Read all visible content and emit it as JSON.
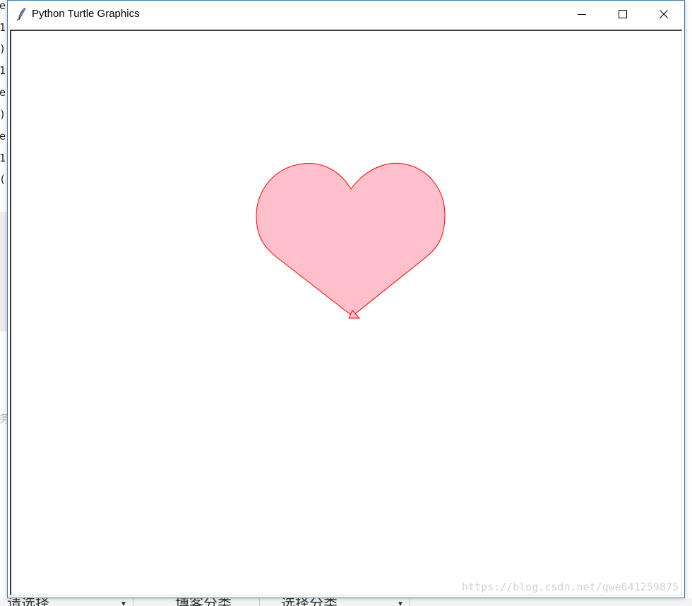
{
  "background": {
    "code_edge_chars": [
      "e",
      "1",
      ")",
      "1",
      "e",
      ")",
      "e",
      "1",
      "("
    ],
    "ghost_char": "务",
    "bottom_bar": {
      "select_1": "请选择",
      "field_2": "博客分类",
      "select_3": "选择分类"
    }
  },
  "window": {
    "title": "Python Turtle Graphics",
    "app_icon": "feather-icon",
    "controls": {
      "minimize_icon": "minimize-icon",
      "maximize_icon": "maximize-icon",
      "close_icon": "close-icon"
    }
  },
  "drawing": {
    "shape": "heart",
    "fill_color": "#ffc0cb",
    "pen_color": "#ff0000",
    "turtle_cursor": "arrow-cursor-icon"
  },
  "watermark": "https://blog.csdn.net/qwe641259875"
}
